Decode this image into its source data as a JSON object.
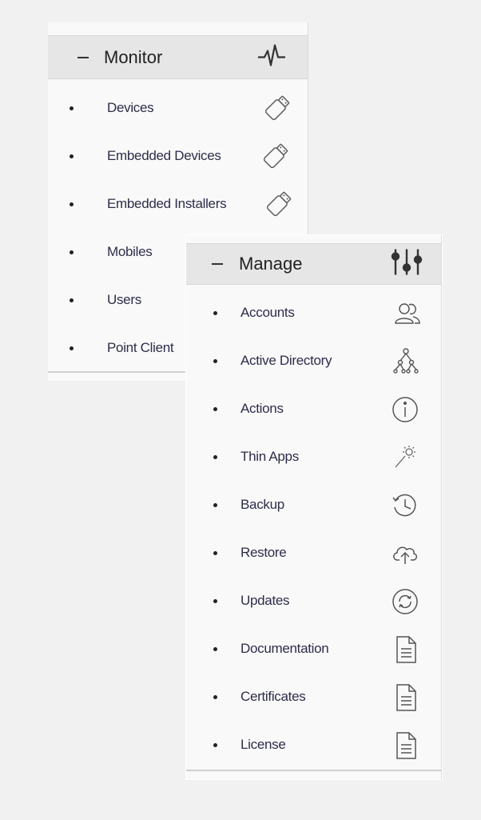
{
  "monitor": {
    "title": "Monitor",
    "header_icon": "pulse-icon",
    "items": [
      {
        "label": "Devices",
        "icon": "usb-drive-icon"
      },
      {
        "label": "Embedded Devices",
        "icon": "usb-drive-icon"
      },
      {
        "label": "Embedded Installers",
        "icon": "usb-drive-icon"
      },
      {
        "label": "Mobiles"
      },
      {
        "label": "Users"
      },
      {
        "label": "Point Client"
      }
    ]
  },
  "manage": {
    "title": "Manage",
    "header_icon": "sliders-icon",
    "items": [
      {
        "label": "Accounts",
        "icon": "users-icon"
      },
      {
        "label": "Active Directory",
        "icon": "tree-icon"
      },
      {
        "label": "Actions",
        "icon": "info-icon"
      },
      {
        "label": "Thin Apps",
        "icon": "wand-icon"
      },
      {
        "label": "Backup",
        "icon": "history-icon"
      },
      {
        "label": "Restore",
        "icon": "cloud-upload-icon"
      },
      {
        "label": "Updates",
        "icon": "refresh-icon"
      },
      {
        "label": "Documentation",
        "icon": "document-icon"
      },
      {
        "label": "Certificates",
        "icon": "document-icon"
      },
      {
        "label": "License",
        "icon": "document-icon"
      }
    ]
  }
}
